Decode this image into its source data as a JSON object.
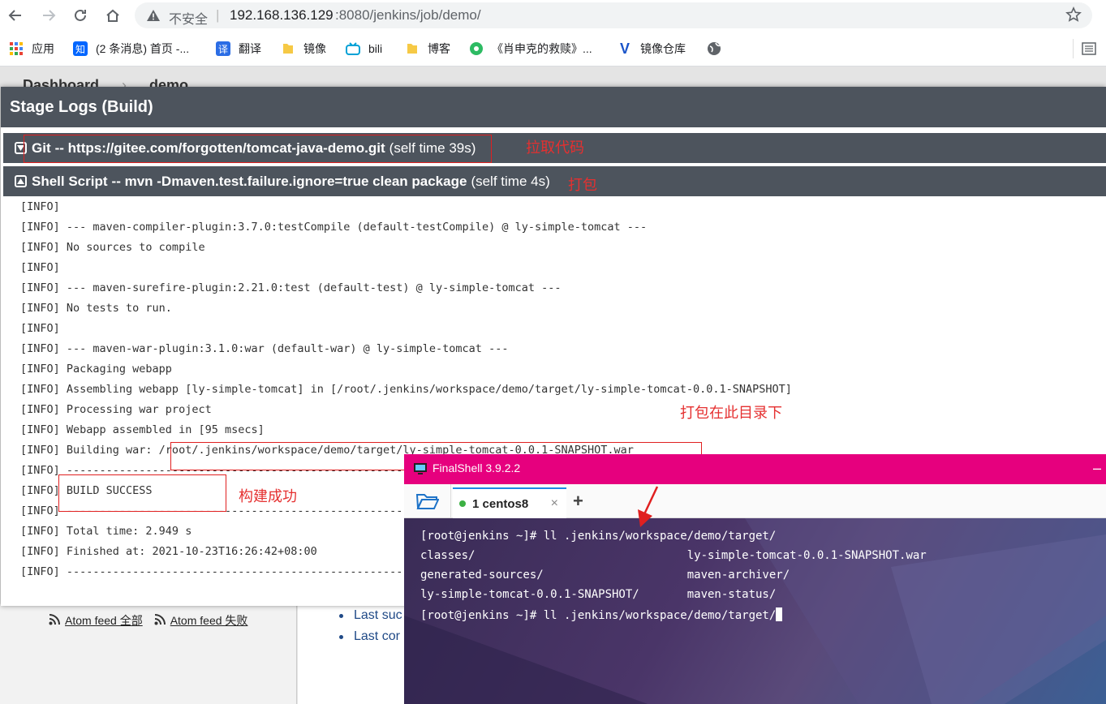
{
  "browser": {
    "url_warning": "不安全",
    "url_host": "192.168.136.129",
    "url_path": ":8080/jenkins/job/demo/"
  },
  "bookmarks": [
    {
      "icon": "apps-grid-icon",
      "label": "应用"
    },
    {
      "icon": "zhihu-icon",
      "label": "(2 条消息) 首页 -..."
    },
    {
      "icon": "translate-icon",
      "label": "翻译"
    },
    {
      "icon": "folder-icon",
      "label": "镜像"
    },
    {
      "icon": "bilibili-icon",
      "label": "bili"
    },
    {
      "icon": "folder-icon",
      "label": "博客"
    },
    {
      "icon": "site-icon",
      "label": "《肖申克的救赎》..."
    },
    {
      "icon": "v-logo-icon",
      "label": "镜像仓库"
    },
    {
      "icon": "globe-icon",
      "label": ""
    }
  ],
  "jenkins": {
    "breadcrumb": [
      "Dashboard",
      "demo"
    ],
    "atom_feed_all": "Atom feed 全部",
    "atom_feed_fail": "Atom feed 失败",
    "links": [
      "Last suc",
      "Last cor"
    ]
  },
  "dialog": {
    "title": "Stage Logs (Build)",
    "steps": [
      {
        "name": "Git",
        "detail": " -- https://gitee.com/forgotten/tomcat-java-demo.git",
        "time": "(self time 39s)"
      },
      {
        "name": "Shell Script",
        "detail": " -- mvn -Dmaven.test.failure.ignore=true clean package",
        "time": "(self time 4s)"
      }
    ],
    "log_lines": [
      "[INFO]",
      "[INFO] --- maven-compiler-plugin:3.7.0:testCompile (default-testCompile) @ ly-simple-tomcat ---",
      "[INFO] No sources to compile",
      "[INFO]",
      "[INFO] --- maven-surefire-plugin:2.21.0:test (default-test) @ ly-simple-tomcat ---",
      "[INFO] No tests to run.",
      "[INFO]",
      "[INFO] --- maven-war-plugin:3.1.0:war (default-war) @ ly-simple-tomcat ---",
      "[INFO] Packaging webapp",
      "[INFO] Assembling webapp [ly-simple-tomcat] in [/root/.jenkins/workspace/demo/target/ly-simple-tomcat-0.0.1-SNAPSHOT]",
      "[INFO] Processing war project",
      "[INFO] Webapp assembled in [95 msecs]",
      "[INFO] Building war: /root/.jenkins/workspace/demo/target/ly-simple-tomcat-0.0.1-SNAPSHOT.war",
      "[INFO] ------------------------------------------------------------------------",
      "[INFO] BUILD SUCCESS",
      "[INFO] ------------------------------------------------------------------------",
      "[INFO] Total time: 2.949 s",
      "[INFO] Finished at: 2021-10-23T16:26:42+08:00",
      "[INFO] ------------------------------------------------------------------------"
    ]
  },
  "annotations": {
    "git": "拉取代码",
    "package": "打包",
    "target_dir": "打包在此目录下",
    "success": "构建成功"
  },
  "finalshell": {
    "title": "FinalShell 3.9.2.2",
    "tab": "1 centos8",
    "tab_close": "×",
    "add": "+",
    "terminal": [
      "[root@jenkins ~]# ll .jenkins/workspace/demo/target/",
      "classes/                               ly-simple-tomcat-0.0.1-SNAPSHOT.war",
      "generated-sources/                     maven-archiver/",
      "ly-simple-tomcat-0.0.1-SNAPSHOT/       maven-status/",
      "[root@jenkins ~]# ll .jenkins/workspace/demo/target/"
    ]
  },
  "colors": {
    "accent_red": "#e02020",
    "finalshell_pink": "#e6007e",
    "jenkins_dark": "#4d545d"
  }
}
